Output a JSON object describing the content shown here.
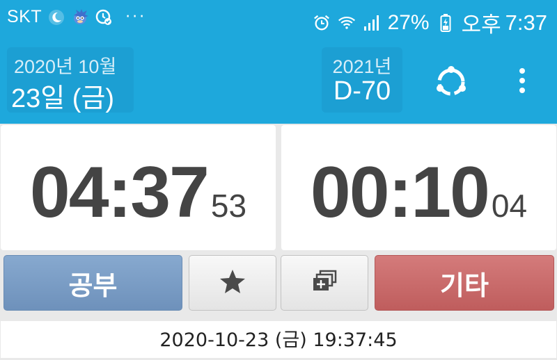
{
  "status_bar": {
    "carrier": "SKT",
    "more": "···",
    "battery": "27%",
    "ampm": "오후",
    "time": "7:37",
    "icons": [
      "moon-icon",
      "sonic-avatar-icon",
      "clock-check-icon",
      "alarm-icon",
      "wifi-icon",
      "signal-icon",
      "battery-icon"
    ]
  },
  "header": {
    "date_line1": "2020년 10월",
    "date_line2": "23일 (금)",
    "dday_year": "2021년",
    "dday_value": "D-70",
    "sync_icon": "sync-circle-icon",
    "menu_icon": "more-vertical-icon",
    "colors": {
      "bar": "#1ea8dc",
      "box": "#1c9fd3"
    }
  },
  "timers": {
    "study": {
      "hhmm": "04:37",
      "seconds": "53"
    },
    "other": {
      "hhmm": "00:10",
      "seconds": "04"
    }
  },
  "buttons": {
    "study_label": "공부",
    "star_icon": "star-icon",
    "copy_icon": "layers-icon",
    "etc_label": "기타",
    "colors": {
      "study": "#7b9dc6",
      "etc": "#c96a6a"
    }
  },
  "footer": {
    "datetime": "2020-10-23 (금) 19:37:45"
  }
}
